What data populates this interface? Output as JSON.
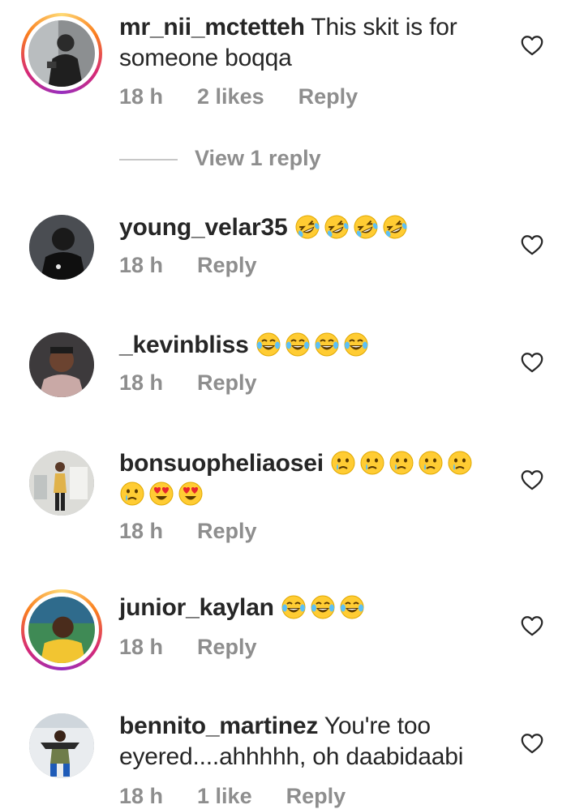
{
  "icons": {
    "like": "heart-outline-icon"
  },
  "colors": {
    "text": "#262626",
    "meta": "#8e8e8e",
    "story_ring": [
      "#feda75",
      "#fa7e1e",
      "#d62976",
      "#962fbf"
    ]
  },
  "comments": [
    {
      "username": "mr_nii_mctetteh",
      "text": " This skit is for someone boqqa",
      "time": "18 h",
      "likes": "2 likes",
      "reply": "Reply",
      "view_replies": "View 1 reply"
    },
    {
      "username": "young_velar35",
      "emojis": [
        "rolling-on-floor-laughing",
        "rolling-on-floor-laughing",
        "rolling-on-floor-laughing",
        "rolling-on-floor-laughing"
      ],
      "time": "18 h",
      "reply": "Reply"
    },
    {
      "username": "_kevinbliss",
      "emojis": [
        "face-with-tears-of-joy",
        "face-with-tears-of-joy",
        "face-with-tears-of-joy",
        "face-with-tears-of-joy"
      ],
      "time": "18 h",
      "reply": "Reply"
    },
    {
      "username": "bonsuopheliaosei",
      "emojis": [
        "crying-face",
        "crying-face",
        "crying-face",
        "crying-face",
        "crying-face",
        "crying-face",
        "heart-eyes",
        "heart-eyes"
      ],
      "time": "18 h",
      "reply": "Reply"
    },
    {
      "username": "junior_kaylan",
      "emojis": [
        "face-with-tears-of-joy",
        "face-with-tears-of-joy",
        "face-with-tears-of-joy"
      ],
      "time": "18 h",
      "reply": "Reply"
    },
    {
      "username": "bennito_martinez",
      "text": " You're too eyered....ahhhhh, oh daabidaabi",
      "time": "18 h",
      "likes": "1 like",
      "reply": "Reply"
    }
  ]
}
